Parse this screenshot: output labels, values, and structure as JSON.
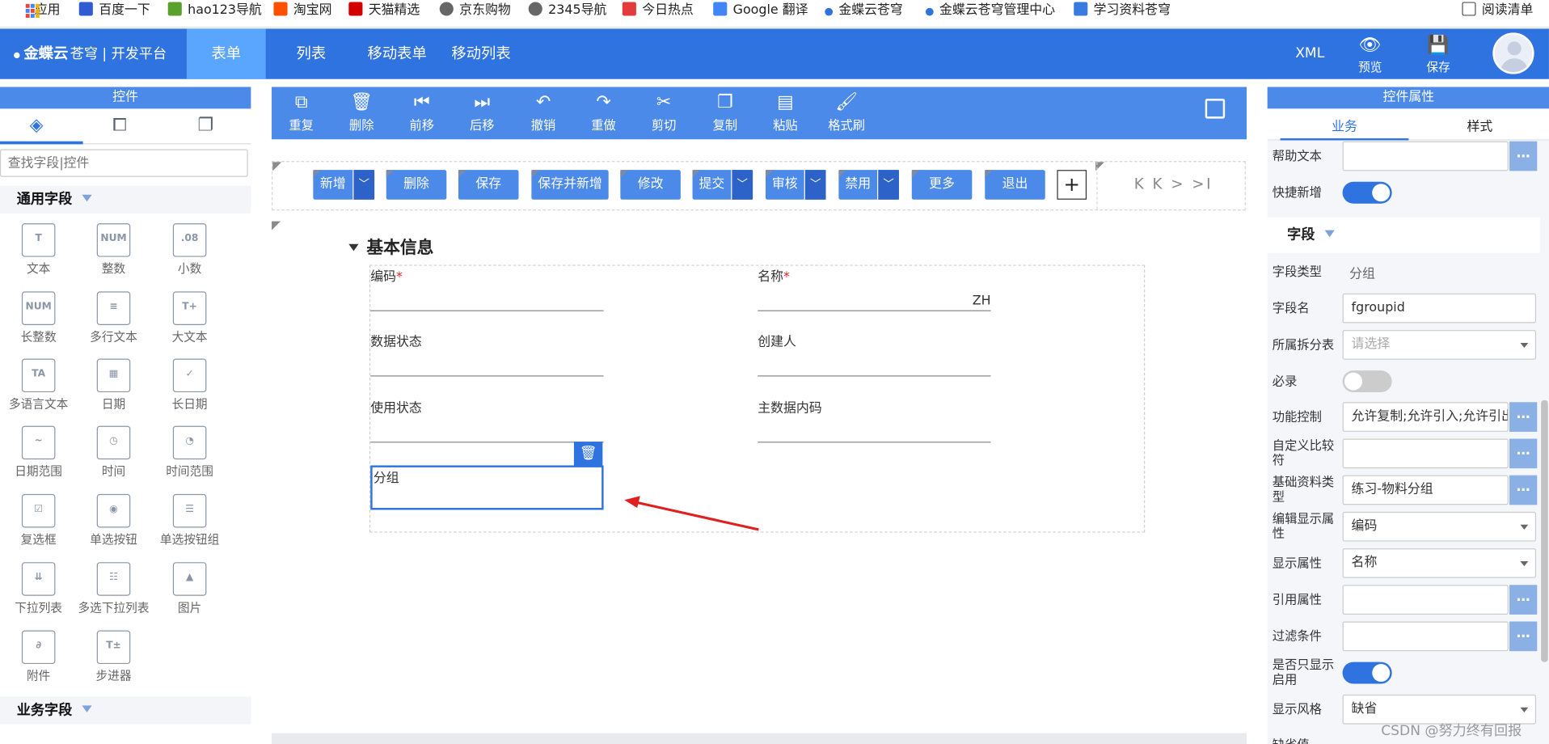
{
  "bookmarks": [
    {
      "name": "apps-icon",
      "label": "应用",
      "color": "#e8453c"
    },
    {
      "name": "baidu-icon",
      "label": "百度一下",
      "color": "#2f5bd3"
    },
    {
      "name": "hao123-icon",
      "label": "hao123导航",
      "color": "#5aa02c"
    },
    {
      "name": "taobao-icon",
      "label": "淘宝网",
      "color": "#ff5000"
    },
    {
      "name": "tmall-icon",
      "label": "天猫精选",
      "color": "#d40000"
    },
    {
      "name": "globe-icon",
      "label": "京东购物",
      "color": "#666666"
    },
    {
      "name": "globe-icon",
      "label": "2345导航",
      "color": "#666666"
    },
    {
      "name": "toutiao-icon",
      "label": "今日热点",
      "color": "#e33b3b"
    },
    {
      "name": "google-translate-icon",
      "label": "Google 翻译",
      "color": "#4285f4"
    },
    {
      "name": "kingdee-icon",
      "label": "金蝶云苍穹",
      "color": "#2f73e0"
    },
    {
      "name": "kingdee-icon",
      "label": "金蝶云苍穹管理中心",
      "color": "#2f73e0"
    },
    {
      "name": "study-icon",
      "label": "学习资料苍穹",
      "color": "#3a7be0"
    }
  ],
  "reading_list": "阅读清单",
  "nav": {
    "logo_brand": "金蝶云",
    "logo_sub": "苍穹",
    "logo_platform": "开发平台",
    "tabs": [
      "表单",
      "列表",
      "移动表单",
      "移动列表"
    ],
    "xml": "XML",
    "preview": "预览",
    "save": "保存"
  },
  "left": {
    "title": "控件",
    "search_placeholder": "查找字段|控件",
    "group_common": "通用字段",
    "group_business": "业务字段",
    "controls": [
      {
        "label": "文本",
        "icon": "T"
      },
      {
        "label": "整数",
        "icon": "NUM"
      },
      {
        "label": "小数",
        "icon": ".08"
      },
      {
        "label": "长整数",
        "icon": "NUM"
      },
      {
        "label": "多行文本",
        "icon": "≡"
      },
      {
        "label": "大文本",
        "icon": "T+"
      },
      {
        "label": "多语言文本",
        "icon": "TA"
      },
      {
        "label": "日期",
        "icon": "▦"
      },
      {
        "label": "长日期",
        "icon": "✓"
      },
      {
        "label": "日期范围",
        "icon": "~"
      },
      {
        "label": "时间",
        "icon": "◷"
      },
      {
        "label": "时间范围",
        "icon": "◔"
      },
      {
        "label": "复选框",
        "icon": "☑"
      },
      {
        "label": "单选按钮",
        "icon": "◉"
      },
      {
        "label": "单选按钮组",
        "icon": "☰"
      },
      {
        "label": "下拉列表",
        "icon": "⇊"
      },
      {
        "label": "多选下拉列表",
        "icon": "☷"
      },
      {
        "label": "图片",
        "icon": "▲"
      },
      {
        "label": "附件",
        "icon": "∂"
      },
      {
        "label": "步进器",
        "icon": "T±"
      }
    ]
  },
  "toolbar": [
    "重复",
    "删除",
    "前移",
    "后移",
    "撤销",
    "重做",
    "剪切",
    "复制",
    "粘贴",
    "格式刷"
  ],
  "toolbar_icons": [
    "⧉",
    "🗑",
    "⏮",
    "⏭",
    "↶",
    "↷",
    "✂",
    "❐",
    "▤",
    "🖌"
  ],
  "form_buttons": [
    {
      "label": "新增",
      "dd": true
    },
    {
      "label": "删除",
      "dd": false
    },
    {
      "label": "保存",
      "dd": false
    },
    {
      "label": "保存并新增",
      "dd": false
    },
    {
      "label": "修改",
      "dd": false
    },
    {
      "label": "提交",
      "dd": true
    },
    {
      "label": "审核",
      "dd": true
    },
    {
      "label": "禁用",
      "dd": true
    },
    {
      "label": "更多",
      "dd": false
    },
    {
      "label": "退出",
      "dd": false
    }
  ],
  "pager": "K K > >I",
  "section": {
    "title": "基本信息",
    "fields": [
      {
        "label": "编码",
        "required": true,
        "value": ""
      },
      {
        "label": "名称",
        "required": true,
        "value": "ZH"
      },
      {
        "label": "数据状态",
        "required": false,
        "value": ""
      },
      {
        "label": "创建人",
        "required": false,
        "value": ""
      },
      {
        "label": "使用状态",
        "required": false,
        "value": ""
      },
      {
        "label": "主数据内码",
        "required": false,
        "value": ""
      }
    ],
    "selected_field": "分组"
  },
  "right": {
    "title": "控件属性",
    "tab_business": "业务",
    "tab_style": "样式",
    "help_text_label": "帮助文本",
    "quick_add_label": "快捷新增",
    "quick_add_on": true,
    "group_field": "字段",
    "field_type_label": "字段类型",
    "field_type_value": "分组",
    "field_name_label": "字段名",
    "field_name_value": "fgroupid",
    "split_table_label": "所属拆分表",
    "split_table_placeholder": "请选择",
    "required_label": "必录",
    "required_on": false,
    "func_control_label": "功能控制",
    "func_control_value": "允许复制;允许引入;允许引出",
    "custom_compare_label": "自定义比较符",
    "base_type_label": "基础资料类型",
    "base_type_value": "练习-物料分组",
    "edit_display_label": "编辑显示属性",
    "edit_display_value": "编码",
    "display_prop_label": "显示属性",
    "display_prop_value": "名称",
    "ref_prop_label": "引用属性",
    "filter_label": "过滤条件",
    "show_enabled_label": "是否只显示启用",
    "show_enabled_on": true,
    "display_style_label": "显示风格",
    "display_style_value": "缺省",
    "default_label": "缺省值"
  },
  "watermark": "CSDN @努力终有回报",
  "colors": {
    "primary": "#2f73e0",
    "toolbar": "#4b8ae8",
    "highlight_tab": "#5aa6ff",
    "arrow": "#e02020"
  }
}
